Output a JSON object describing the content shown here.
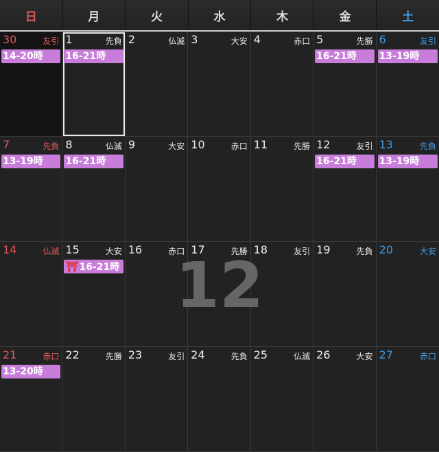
{
  "weekdays": [
    "日",
    "月",
    "火",
    "水",
    "木",
    "金",
    "土"
  ],
  "month_watermark": "12",
  "weeks": [
    [
      {
        "day": "30",
        "rokuyo": "友引",
        "event": "14-20時"
      },
      {
        "day": "1",
        "rokuyo": "先負",
        "event": "16-21時"
      },
      {
        "day": "2",
        "rokuyo": "仏滅",
        "event": ""
      },
      {
        "day": "3",
        "rokuyo": "大安",
        "event": ""
      },
      {
        "day": "4",
        "rokuyo": "赤口",
        "event": ""
      },
      {
        "day": "5",
        "rokuyo": "先勝",
        "event": "16-21時"
      },
      {
        "day": "6",
        "rokuyo": "友引",
        "event": "13-19時"
      }
    ],
    [
      {
        "day": "7",
        "rokuyo": "先負",
        "event": "13-19時"
      },
      {
        "day": "8",
        "rokuyo": "仏滅",
        "event": "16-21時"
      },
      {
        "day": "9",
        "rokuyo": "大安",
        "event": ""
      },
      {
        "day": "10",
        "rokuyo": "赤口",
        "event": ""
      },
      {
        "day": "11",
        "rokuyo": "先勝",
        "event": ""
      },
      {
        "day": "12",
        "rokuyo": "友引",
        "event": "16-21時"
      },
      {
        "day": "13",
        "rokuyo": "先負",
        "event": "13-19時"
      }
    ],
    [
      {
        "day": "14",
        "rokuyo": "仏滅",
        "event": ""
      },
      {
        "day": "15",
        "rokuyo": "大安",
        "event": "16-21時",
        "icon": "torii-icon",
        "icon_glyph": "⛩"
      },
      {
        "day": "16",
        "rokuyo": "赤口",
        "event": ""
      },
      {
        "day": "17",
        "rokuyo": "先勝",
        "event": ""
      },
      {
        "day": "18",
        "rokuyo": "友引",
        "event": ""
      },
      {
        "day": "19",
        "rokuyo": "先負",
        "event": ""
      },
      {
        "day": "20",
        "rokuyo": "大安",
        "event": ""
      }
    ],
    [
      {
        "day": "21",
        "rokuyo": "赤口",
        "event": "13-20時"
      },
      {
        "day": "22",
        "rokuyo": "先勝",
        "event": ""
      },
      {
        "day": "23",
        "rokuyo": "友引",
        "event": ""
      },
      {
        "day": "24",
        "rokuyo": "先負",
        "event": ""
      },
      {
        "day": "25",
        "rokuyo": "仏滅",
        "event": ""
      },
      {
        "day": "26",
        "rokuyo": "大安",
        "event": ""
      },
      {
        "day": "27",
        "rokuyo": "赤口",
        "event": ""
      }
    ]
  ],
  "colors": {
    "sunday": "#e05a5a",
    "saturday": "#3f9be6",
    "event": "#c77dd9",
    "background": "#1f1f1f"
  }
}
